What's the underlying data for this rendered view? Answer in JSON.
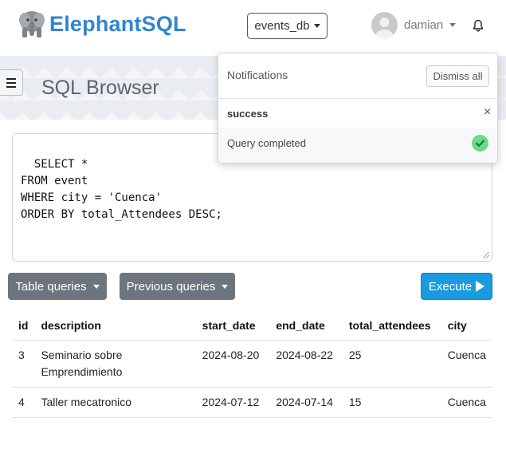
{
  "brand": {
    "name": "ElephantSQL"
  },
  "database_selector": {
    "value": "events_db"
  },
  "user": {
    "name": "damian"
  },
  "page": {
    "title": "SQL Browser"
  },
  "editor": {
    "query": "SELECT *\nFROM event\nWHERE city = 'Cuenca'\nORDER BY total_Attendees DESC;"
  },
  "toolbar": {
    "table_queries_label": "Table queries",
    "previous_queries_label": "Previous queries",
    "execute_label": "Execute"
  },
  "results": {
    "columns": [
      "id",
      "description",
      "start_date",
      "end_date",
      "total_attendees",
      "city"
    ],
    "rows": [
      [
        "3",
        "Seminario sobre Emprendimiento",
        "2024-08-20",
        "2024-08-22",
        "25",
        "Cuenca"
      ],
      [
        "4",
        "Taller mecatronico",
        "2024-07-12",
        "2024-07-14",
        "15",
        "Cuenca"
      ]
    ]
  },
  "notifications": {
    "title": "Notifications",
    "dismiss_label": "Dismiss all",
    "items": [
      {
        "status": "success",
        "close_label": "×",
        "message": "Query completed",
        "icon": "check-circle-icon",
        "color": "#6dd98a"
      }
    ]
  },
  "colors": {
    "brand": "#2f86cf",
    "execute": "#1a9be0",
    "secondary_button": "#6c757d"
  }
}
